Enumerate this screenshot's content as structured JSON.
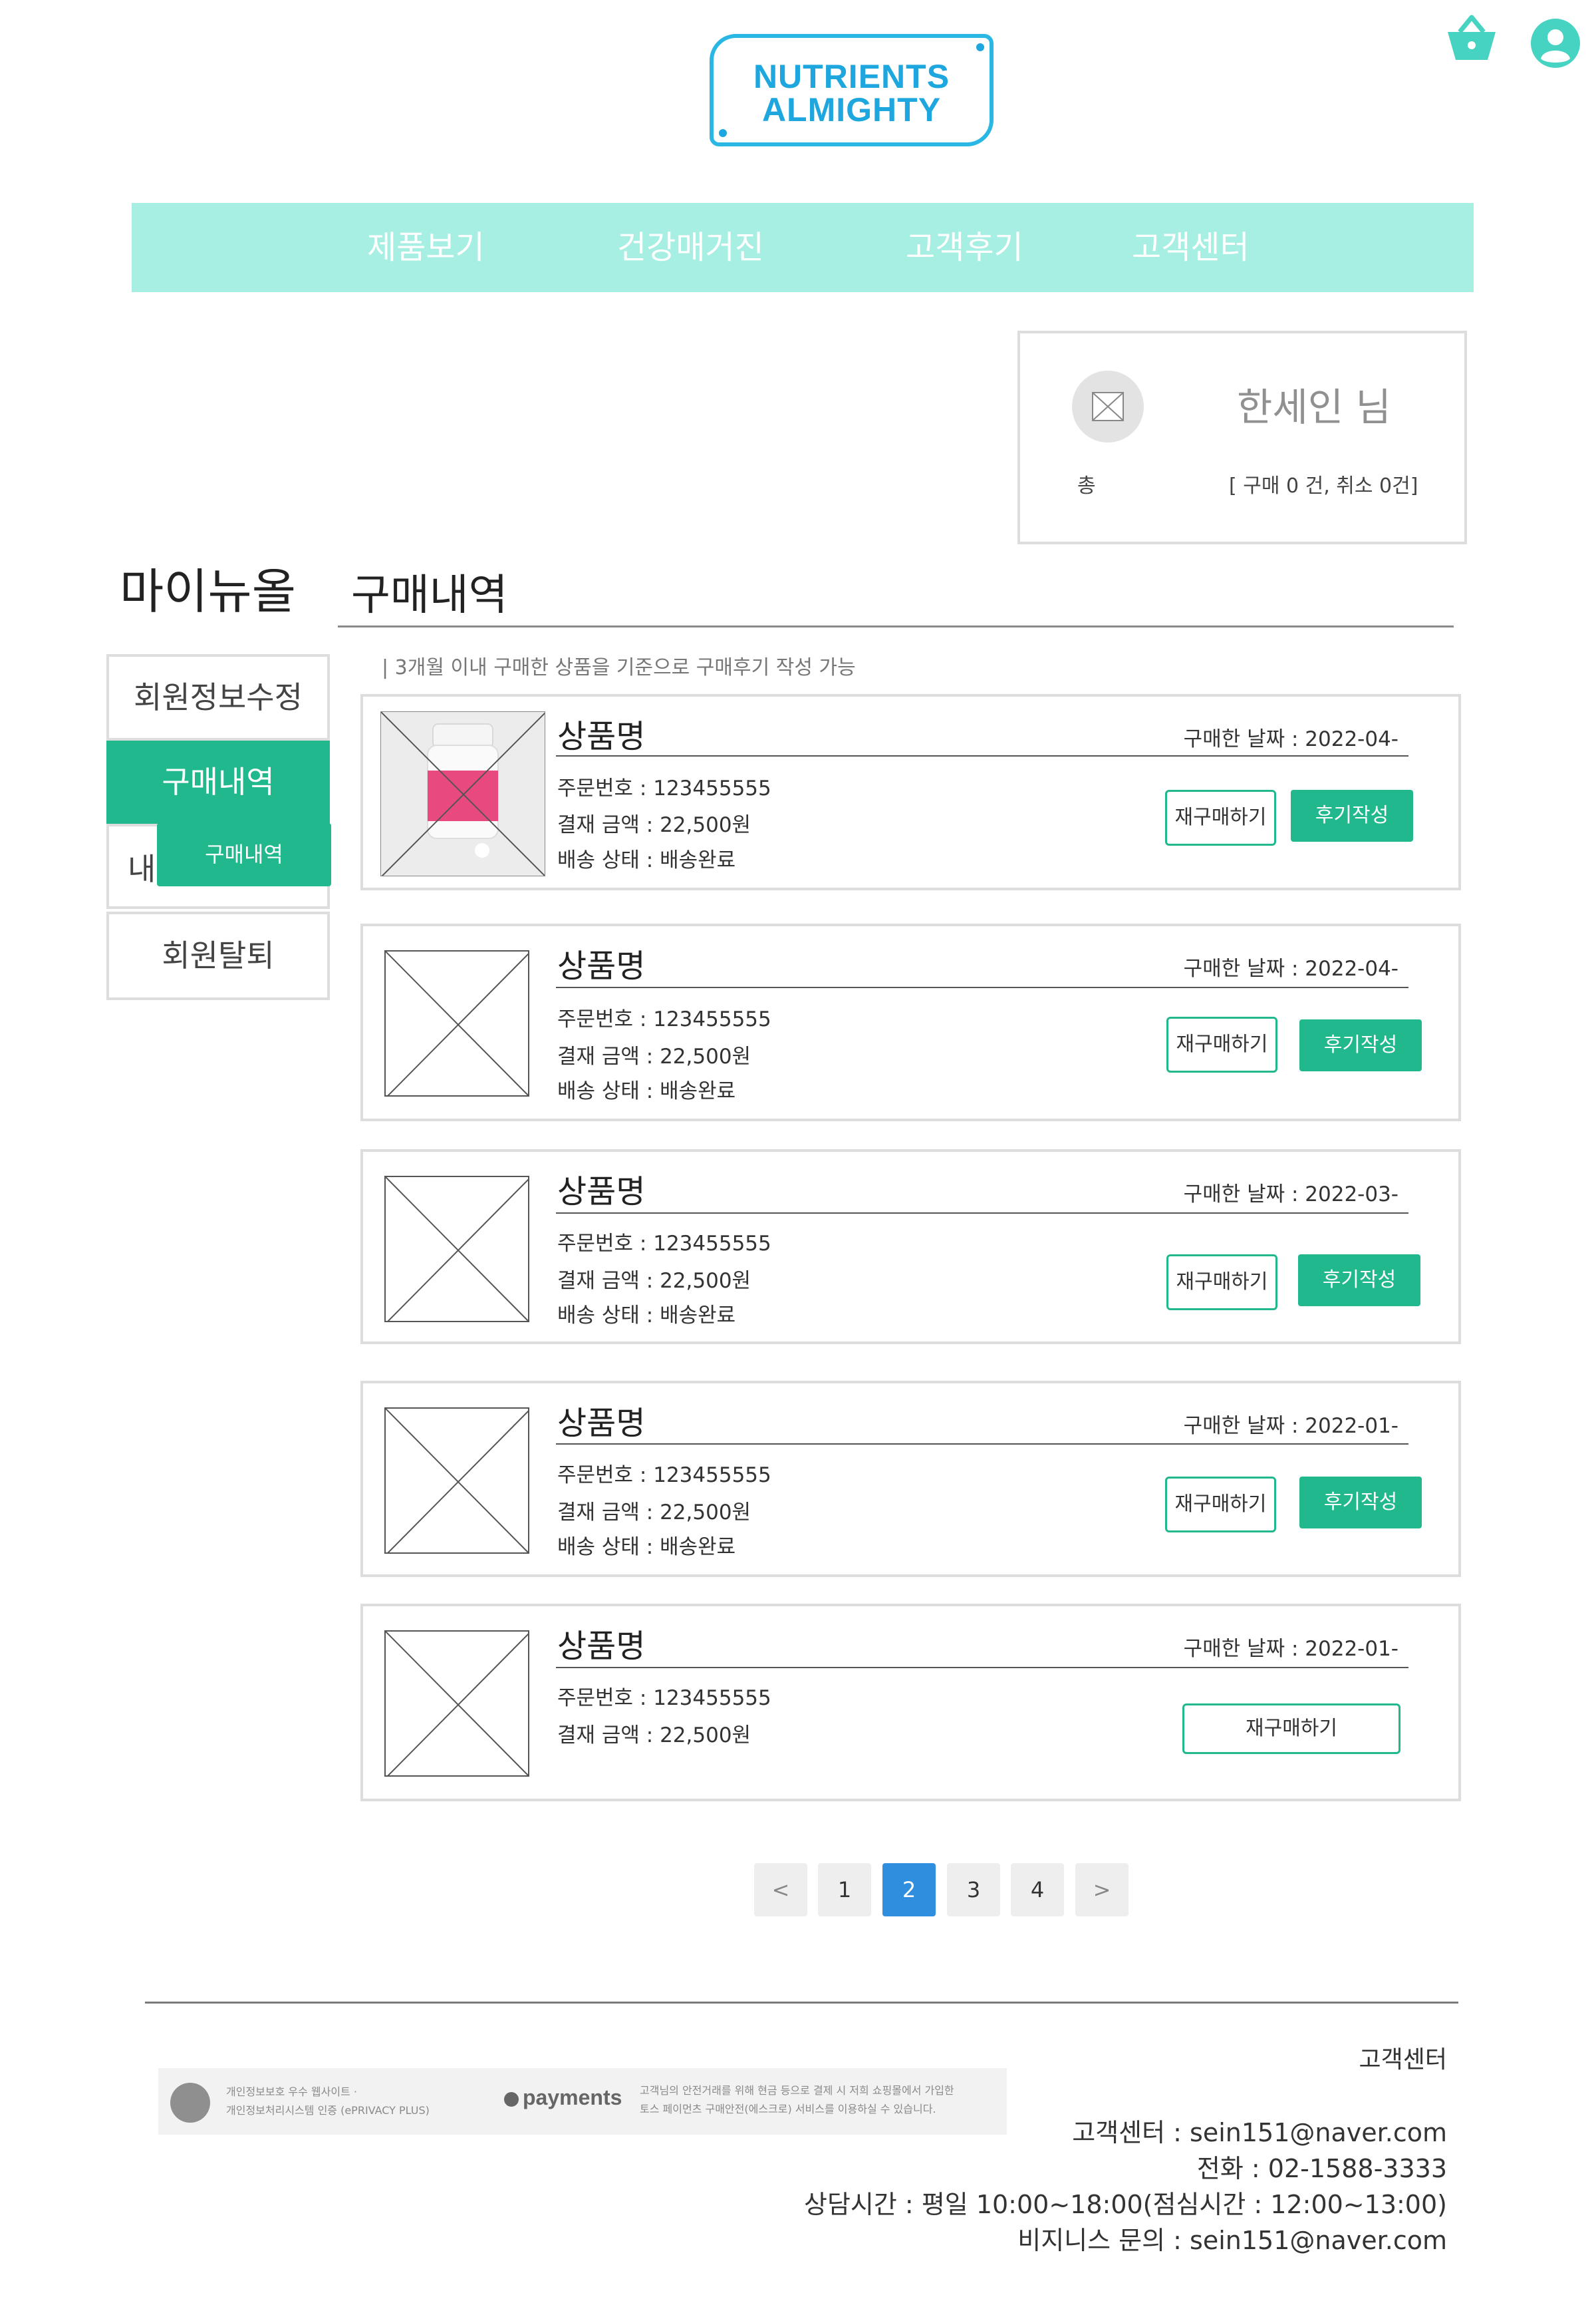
{
  "brand": {
    "line1": "NUTRIENTS",
    "line2": "ALMIGHTY"
  },
  "header_icons": {
    "cart": "basket-icon",
    "account": "user-icon"
  },
  "nav": {
    "items": [
      "제품보기",
      "건강매거진",
      "고객후기",
      "고객센터"
    ]
  },
  "profile": {
    "name": "한세인 님",
    "total_label": "총",
    "summary": "[ 구매 0 건, 취소 0건]"
  },
  "sidebar": {
    "title": "마이뉴올",
    "items": [
      "회원정보수정",
      "구매내역",
      "내",
      "회원탈퇴"
    ],
    "submenu_label": "구매내역"
  },
  "main": {
    "title": "구매내역",
    "notice": "| 3개월 이내 구매한 상품을 기준으로  구매후기 작성 가능"
  },
  "orders": [
    {
      "name": "상품명",
      "date": "구매한 날짜 : 2022-04-",
      "order_no": "주문번호 : 123455555",
      "amount": "결재 금액 : 22,500원",
      "status": "배송 상태 : 배송완료",
      "rebuy": "재구매하기",
      "review": "후기작성",
      "has_image": true
    },
    {
      "name": "상품명",
      "date": "구매한 날짜 : 2022-04-",
      "order_no": "주문번호 : 123455555",
      "amount": "결재 금액 : 22,500원",
      "status": "배송 상태 : 배송완료",
      "rebuy": "재구매하기",
      "review": "후기작성",
      "has_image": false
    },
    {
      "name": "상품명",
      "date": "구매한 날짜 : 2022-03-",
      "order_no": "주문번호 : 123455555",
      "amount": "결재 금액 : 22,500원",
      "status": "배송 상태 : 배송완료",
      "rebuy": "재구매하기",
      "review": "후기작성",
      "has_image": false
    },
    {
      "name": "상품명",
      "date": "구매한 날짜 : 2022-01-",
      "order_no": "주문번호 : 123455555",
      "amount": "결재 금액 : 22,500원",
      "status": "배송 상태 : 배송완료",
      "rebuy": "재구매하기",
      "review": "후기작성",
      "has_image": false
    },
    {
      "name": "상품명",
      "date": "구매한 날짜 : 2022-01-",
      "order_no": "주문번호 : 123455555",
      "amount": "결재 금액 : 22,500원",
      "rebuy": "재구매하기",
      "has_image": false
    }
  ],
  "pagination": {
    "prev": "<",
    "pages": [
      "1",
      "2",
      "3",
      "4"
    ],
    "current": "2",
    "next": ">"
  },
  "footer": {
    "badge1_line1": "개인정보보호 우수 웹사이트 ·",
    "badge1_line2": "개인정보처리시스템 인증 (ePRIVACY PLUS)",
    "payments": "payments",
    "badge2_line1": "고객님의 안전거래를 위해 현금 등으로 결제 시 저희 쇼핑몰에서 가입한",
    "badge2_line2": "토스 페이먼츠 구매안전(에스크로) 서비스를 이용하실 수 있습니다.",
    "cs_title": "고객센터",
    "email": "고객센터 : sein151@naver.com",
    "phone": "전화 : 02-1588-3333",
    "hours": "상담시간 : 평일 10:00~18:00(점심시간 : 12:00~13:00)",
    "biz": "비지니스 문의 : sein151@naver.com"
  },
  "colors": {
    "accent": "#22b88e",
    "nav_bg": "#a6efe2",
    "logo": "#1ea7de",
    "pagination_active": "#2f8fde",
    "icons": "#46d3c2"
  }
}
